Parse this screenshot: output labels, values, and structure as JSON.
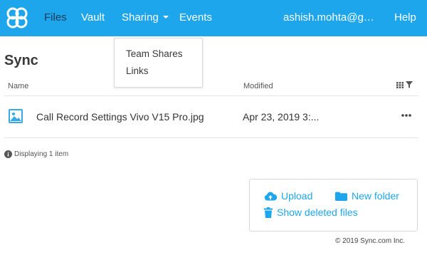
{
  "nav": {
    "files": "Files",
    "vault": "Vault",
    "sharing": "Sharing",
    "events": "Events",
    "user": "ashish.mohta@gmai...",
    "help": "Help"
  },
  "sharing_menu": {
    "items": [
      "Team Shares",
      "Links"
    ]
  },
  "page": {
    "title": "Sync"
  },
  "table": {
    "columns": {
      "name": "Name",
      "modified": "Modified"
    },
    "rows": [
      {
        "name": "Call Record Settings Vivo V15 Pro.jpg",
        "modified": "Apr 23, 2019 3:...",
        "icon": "image-file-icon"
      }
    ]
  },
  "status": {
    "text": "Displaying 1 item"
  },
  "actions": {
    "upload": "Upload",
    "new_folder": "New folder",
    "show_deleted": "Show deleted files"
  },
  "footer": {
    "copyright": "© 2019 Sync.com Inc."
  },
  "colors": {
    "accent": "#1ea6ec",
    "active_nav": "#1d3b5a"
  }
}
